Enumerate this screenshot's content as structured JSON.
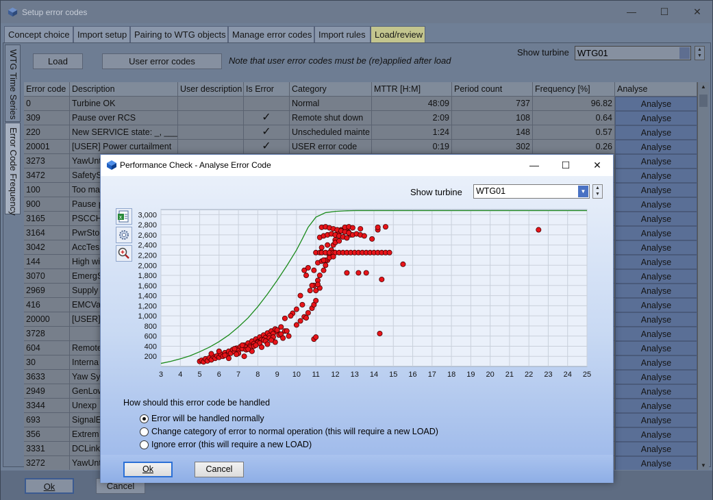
{
  "window": {
    "title": "Setup error codes"
  },
  "tabs": [
    "Concept choice",
    "Import setup",
    "Pairing to WTG objects",
    "Manage error codes",
    "Import rules",
    "Load/review"
  ],
  "active_tab": "Load/review",
  "side_tabs": [
    "WTG Time Series",
    "Error Code Frequency"
  ],
  "toolbar": {
    "load": "Load",
    "user_codes": "User error codes",
    "note": "Note that user error codes must be (re)applied after load",
    "show_turbine_label": "Show turbine",
    "turbine_value": "WTG01"
  },
  "grid": {
    "columns": [
      "Error code",
      "Description",
      "User description",
      "Is Error",
      "Category",
      "MTTR [H:M]",
      "Period count",
      "Frequency [%]",
      "Analyse"
    ],
    "rows": [
      {
        "code": "0",
        "desc": "Turbine OK",
        "user": "",
        "is_error": "",
        "category": "Normal",
        "mttr": "48:09",
        "count": "737",
        "freq": "96.82"
      },
      {
        "code": "309",
        "desc": "Pause over RCS",
        "user": "",
        "is_error": "✓",
        "category": "Remote shut down",
        "mttr": "2:09",
        "count": "108",
        "freq": "0.64"
      },
      {
        "code": "220",
        "desc": "New SERVICE state: _, ___",
        "user": "",
        "is_error": "✓",
        "category": "Unscheduled mainte",
        "mttr": "1:24",
        "count": "148",
        "freq": "0.57"
      },
      {
        "code": "20001",
        "desc": "[USER] Power curtailment",
        "user": "",
        "is_error": "✓",
        "category": "USER error code",
        "mttr": "0:19",
        "count": "302",
        "freq": "0.26"
      },
      {
        "code": "3273",
        "desc": "YawUnt",
        "user": "",
        "is_error": "",
        "category": "",
        "mttr": "",
        "count": "",
        "freq": ""
      },
      {
        "code": "3472",
        "desc": "SafetyS",
        "user": "",
        "is_error": "",
        "category": "",
        "mttr": "",
        "count": "",
        "freq": ""
      },
      {
        "code": "100",
        "desc": "Too ma",
        "user": "",
        "is_error": "",
        "category": "",
        "mttr": "",
        "count": "",
        "freq": ""
      },
      {
        "code": "900",
        "desc": "Pause p",
        "user": "",
        "is_error": "",
        "category": "",
        "mttr": "",
        "count": "",
        "freq": ""
      },
      {
        "code": "3165",
        "desc": "PSCCHV",
        "user": "",
        "is_error": "",
        "category": "",
        "mttr": "",
        "count": "",
        "freq": ""
      },
      {
        "code": "3164",
        "desc": "PwrSto",
        "user": "",
        "is_error": "",
        "category": "",
        "mttr": "",
        "count": "",
        "freq": ""
      },
      {
        "code": "3042",
        "desc": "AccTes",
        "user": "",
        "is_error": "",
        "category": "",
        "mttr": "",
        "count": "",
        "freq": ""
      },
      {
        "code": "144",
        "desc": "High wi",
        "user": "",
        "is_error": "",
        "category": "",
        "mttr": "",
        "count": "",
        "freq": ""
      },
      {
        "code": "3070",
        "desc": "EmergS",
        "user": "",
        "is_error": "",
        "category": "",
        "mttr": "",
        "count": "",
        "freq": ""
      },
      {
        "code": "2969",
        "desc": "Supply",
        "user": "",
        "is_error": "",
        "category": "",
        "mttr": "",
        "count": "",
        "freq": ""
      },
      {
        "code": "416",
        "desc": "EMCVal",
        "user": "",
        "is_error": "",
        "category": "",
        "mttr": "",
        "count": "",
        "freq": ""
      },
      {
        "code": "20000",
        "desc": "[USER]",
        "user": "",
        "is_error": "",
        "category": "",
        "mttr": "",
        "count": "",
        "freq": ""
      },
      {
        "code": "3728",
        "desc": "",
        "user": "",
        "is_error": "",
        "category": "",
        "mttr": "",
        "count": "",
        "freq": ""
      },
      {
        "code": "604",
        "desc": "Remote",
        "user": "",
        "is_error": "",
        "category": "",
        "mttr": "",
        "count": "",
        "freq": ""
      },
      {
        "code": "30",
        "desc": "Interna",
        "user": "",
        "is_error": "",
        "category": "",
        "mttr": "",
        "count": "",
        "freq": ""
      },
      {
        "code": "3633",
        "desc": "Yaw Sy",
        "user": "",
        "is_error": "",
        "category": "",
        "mttr": "",
        "count": "",
        "freq": ""
      },
      {
        "code": "2949",
        "desc": "GenLow",
        "user": "",
        "is_error": "",
        "category": "",
        "mttr": "",
        "count": "",
        "freq": ""
      },
      {
        "code": "3344",
        "desc": "Unexp",
        "user": "",
        "is_error": "",
        "category": "",
        "mttr": "",
        "count": "",
        "freq": ""
      },
      {
        "code": "693",
        "desc": "SignalE",
        "user": "",
        "is_error": "",
        "category": "",
        "mttr": "",
        "count": "",
        "freq": ""
      },
      {
        "code": "356",
        "desc": "Extrem",
        "user": "",
        "is_error": "",
        "category": "",
        "mttr": "",
        "count": "",
        "freq": ""
      },
      {
        "code": "3331",
        "desc": "DCLink",
        "user": "",
        "is_error": "",
        "category": "",
        "mttr": "",
        "count": "",
        "freq": ""
      },
      {
        "code": "3272",
        "desc": "YawUnt",
        "user": "",
        "is_error": "",
        "category": "",
        "mttr": "",
        "count": "",
        "freq": ""
      }
    ],
    "analyse_label": "Analyse"
  },
  "outer_buttons": {
    "ok": "Ok",
    "cancel": "Cancel"
  },
  "dialog": {
    "title": "Performance Check - Analyse Error Code",
    "show_turbine_label": "Show turbine",
    "turbine_value": "WTG01",
    "question": "How should this error code be handled",
    "options": [
      {
        "label": "Error will be handled normally",
        "selected": true
      },
      {
        "label": "Change category of error to normal operation (this will require a new LOAD)",
        "selected": false
      },
      {
        "label": "Ignore error (this will require a new LOAD)",
        "selected": false
      }
    ],
    "ok": "Ok",
    "cancel": "Cancel"
  },
  "chart_data": {
    "type": "scatter",
    "title": "",
    "xlabel": "",
    "ylabel": "",
    "xlim": [
      3,
      25
    ],
    "ylim": [
      0,
      3100
    ],
    "xticks": [
      3,
      4,
      5,
      6,
      7,
      8,
      9,
      10,
      11,
      12,
      13,
      14,
      15,
      16,
      17,
      18,
      19,
      20,
      21,
      22,
      23,
      24,
      25
    ],
    "yticks": [
      200,
      400,
      600,
      800,
      1000,
      1200,
      1400,
      1600,
      1800,
      2000,
      2200,
      2400,
      2600,
      2800,
      3000
    ],
    "grid": true,
    "colors": {
      "points": "#e8141a",
      "curve": "#1a8a1a"
    },
    "series": [
      {
        "type": "line",
        "x": [
          3,
          3.5,
          4,
          4.5,
          5,
          5.5,
          6,
          6.5,
          7,
          7.5,
          8,
          8.5,
          9,
          9.5,
          10,
          10.3,
          10.6,
          11,
          11.5,
          12,
          12.5,
          13,
          14,
          25
        ],
        "y": [
          60,
          100,
          150,
          210,
          290,
          380,
          490,
          620,
          780,
          960,
          1180,
          1430,
          1700,
          1990,
          2300,
          2520,
          2750,
          2950,
          3040,
          3065,
          3075,
          3080,
          3080,
          3080
        ]
      },
      {
        "type": "scatter",
        "x": [
          5.0,
          5.1,
          5.2,
          5.3,
          5.4,
          5.5,
          5.6,
          5.7,
          5.8,
          5.9,
          6.0,
          6.1,
          6.2,
          6.3,
          6.4,
          6.5,
          6.6,
          6.7,
          6.8,
          6.9,
          7.0,
          7.1,
          7.2,
          7.3,
          7.4,
          7.5,
          7.6,
          7.7,
          7.8,
          7.9,
          8.0,
          8.1,
          8.2,
          8.3,
          8.4,
          8.5,
          8.6,
          8.7,
          8.8,
          8.9,
          9.0,
          5.6,
          6.0,
          6.3,
          6.8,
          7.2,
          7.6,
          8.0,
          8.3,
          8.6,
          9.1,
          9.4,
          6.5,
          7.0,
          7.4,
          7.8,
          8.1,
          8.4,
          8.8,
          9.2,
          7.3,
          7.7,
          8.2,
          8.5,
          8.9,
          9.3,
          9.6,
          6.9,
          7.5,
          7.9,
          8.7,
          9.5,
          10.0,
          10.2,
          10.4,
          10.6,
          10.8,
          10.9,
          11.0,
          10.7,
          10.9,
          11.1,
          11.2,
          11.4,
          11.5,
          11.6,
          11.7,
          11.8,
          11.9,
          12.0,
          12.1,
          12.2,
          12.3,
          12.4,
          12.5,
          12.6,
          12.7,
          12.8,
          11.3,
          11.5,
          11.7,
          11.9,
          12.1,
          12.3,
          12.5,
          12.7,
          11.2,
          11.4,
          11.6,
          11.8,
          12.0,
          12.2,
          12.4,
          12.6,
          11.0,
          11.2,
          11.3,
          11.5,
          11.7,
          11.9,
          12.0,
          12.2,
          12.4,
          12.6,
          12.8,
          13.0,
          13.2,
          13.4,
          13.6,
          13.8,
          14.0,
          14.2,
          14.4,
          14.6,
          14.8,
          11.1,
          11.3,
          11.5,
          11.7,
          11.9,
          11.3,
          11.6,
          12.0,
          12.2,
          12.9,
          13.1,
          13.3,
          13.5,
          13.9,
          12.5,
          12.7,
          12.9,
          13.3,
          14.2,
          14.6,
          14.2,
          15.5,
          12.6,
          13.2,
          13.6,
          14.4,
          10.4,
          10.6,
          10.5,
          10.8,
          11.0,
          11.2,
          11.4,
          10.9,
          11.1,
          10.3,
          10.2,
          10.0,
          10.5,
          9.8,
          9.7,
          9.4,
          9.2,
          9.0,
          10.9,
          11.0,
          14.3,
          22.5
        ],
        "y": [
          100,
          120,
          90,
          150,
          110,
          170,
          130,
          200,
          160,
          210,
          180,
          240,
          200,
          270,
          230,
          300,
          260,
          330,
          290,
          360,
          320,
          390,
          350,
          420,
          380,
          460,
          410,
          500,
          450,
          540,
          490,
          580,
          530,
          620,
          570,
          660,
          610,
          700,
          650,
          740,
          690,
          250,
          300,
          220,
          350,
          420,
          380,
          470,
          520,
          560,
          620,
          700,
          160,
          260,
          330,
          400,
          460,
          500,
          580,
          640,
          200,
          300,
          380,
          440,
          480,
          560,
          600,
          240,
          340,
          420,
          520,
          700,
          820,
          900,
          980,
          1060,
          1150,
          1220,
          1300,
          1500,
          1600,
          1700,
          1800,
          1900,
          2000,
          2100,
          2200,
          2300,
          2400,
          2500,
          2600,
          2650,
          2700,
          2680,
          2720,
          2700,
          2650,
          2600,
          2750,
          2760,
          2740,
          2720,
          2700,
          2680,
          2660,
          2640,
          2550,
          2580,
          2600,
          2620,
          2600,
          2580,
          2560,
          2540,
          2250,
          2250,
          2250,
          2250,
          2250,
          2250,
          2250,
          2250,
          2250,
          2250,
          2250,
          2250,
          2250,
          2250,
          2250,
          2250,
          2250,
          2250,
          2250,
          2250,
          2250,
          2050,
          2080,
          2100,
          2150,
          2170,
          2350,
          2400,
          2450,
          2480,
          2600,
          2620,
          2600,
          2580,
          2520,
          2750,
          2760,
          2740,
          2720,
          2700,
          2760,
          2750,
          2020,
          1850,
          1850,
          1850,
          1720,
          1900,
          1950,
          1800,
          1600,
          1500,
          1550,
          2100,
          1900,
          1620,
          1220,
          1400,
          1130,
          960,
          1050,
          1000,
          950,
          780,
          720,
          540,
          580,
          650,
          2700
        ]
      }
    ]
  }
}
